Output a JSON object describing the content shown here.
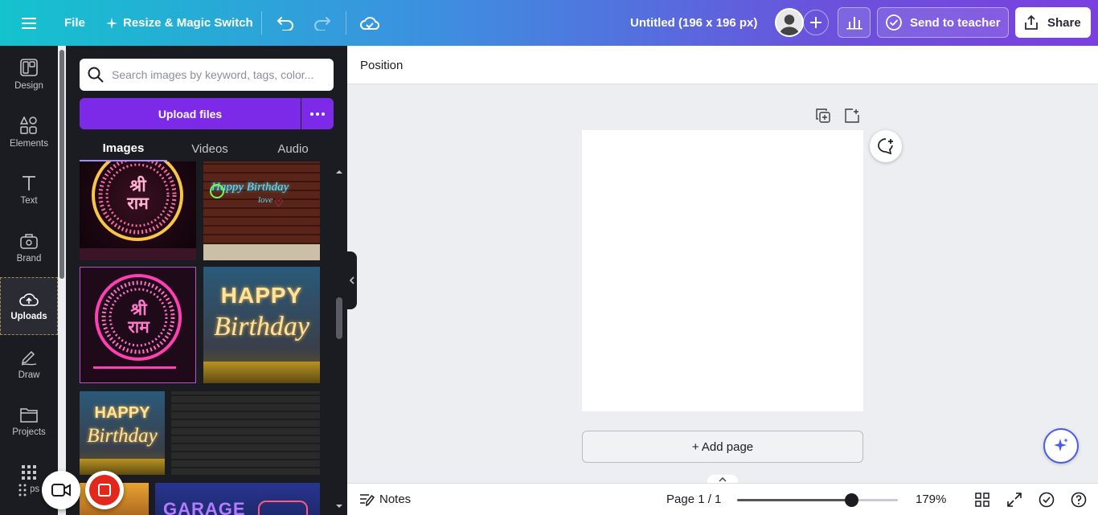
{
  "topbar": {
    "file_label": "File",
    "resize_label": "Resize & Magic Switch",
    "title": "Untitled (196 x 196 px)",
    "send_label": "Send to teacher",
    "share_label": "Share"
  },
  "rail": {
    "items": [
      {
        "label": "Design"
      },
      {
        "label": "Elements"
      },
      {
        "label": "Text"
      },
      {
        "label": "Brand"
      },
      {
        "label": "Uploads"
      },
      {
        "label": "Draw"
      },
      {
        "label": "Projects"
      },
      {
        "label": "Apps"
      }
    ],
    "active": "Uploads"
  },
  "panel": {
    "search_placeholder": "Search images by keyword, tags, color...",
    "upload_label": "Upload files",
    "tabs": [
      {
        "label": "Images"
      },
      {
        "label": "Videos"
      },
      {
        "label": "Audio"
      }
    ],
    "active_tab": "Images",
    "thumbs": {
      "shri_ram_gold": {
        "line1": "श्री",
        "line2": "राम"
      },
      "happy_birthday_brick": {
        "line1": "Happy Birthday",
        "line2": "love"
      },
      "shri_ram_pink": {
        "line1": "श्री",
        "line2": "राम"
      },
      "happy_birthday_gold": {
        "line1": "HAPPY",
        "line2": "Birthday"
      },
      "happy_birthday_small": {
        "line1": "HAPPY",
        "line2": "Birthday"
      },
      "garage": {
        "line1": "GARAGE"
      }
    }
  },
  "main": {
    "position_label": "Position",
    "add_page_label": "+ Add page"
  },
  "bottombar": {
    "notes_label": "Notes",
    "page_label": "Page 1 / 1",
    "zoom_label": "179%",
    "zoom_fraction": 0.71
  },
  "colors": {
    "accent_purple": "#7d2ae8",
    "record_red": "#e0281c"
  }
}
